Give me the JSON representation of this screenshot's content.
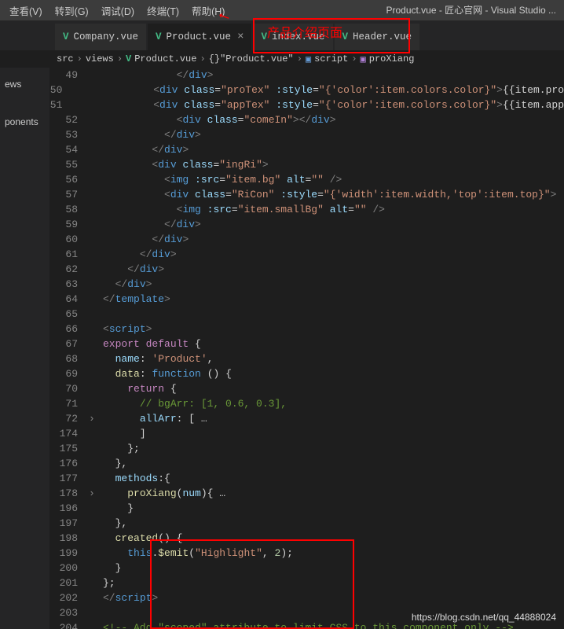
{
  "title_bar": "Product.vue - 匠心官网 - Visual Studio ...",
  "menu": [
    "查看(V)",
    "转到(G)",
    "调试(D)",
    "终端(T)",
    "帮助(H)"
  ],
  "tabs": [
    {
      "label": "Company.vue",
      "active": false,
      "close": false
    },
    {
      "label": "Product.vue",
      "active": true,
      "close": true
    },
    {
      "label": "index.vue",
      "active": false,
      "close": false
    },
    {
      "label": "Header.vue",
      "active": false,
      "close": false
    }
  ],
  "annotation": "产品介绍页面",
  "breadcrumbs": {
    "parts": [
      "src",
      "views",
      "Product.vue",
      "{}",
      "\"Product.vue\"",
      "script",
      "proXiang"
    ]
  },
  "sidebar": [
    "ews",
    "ponents"
  ],
  "lines": [
    {
      "n": 49,
      "fold": "",
      "html": "            <span class='c-tag'>&lt;/</span><span class='c-elem'>div</span><span class='c-tag'>&gt;</span>"
    },
    {
      "n": 50,
      "fold": "",
      "html": "            <span class='c-tag'>&lt;</span><span class='c-elem'>div</span> <span class='c-attr'>class</span><span class='c-punc'>=</span><span class='c-str'>\"proTex\"</span> <span class='c-attr'>:style</span><span class='c-punc'>=</span><span class='c-str'>\"{'color':item.colors.color}\"</span><span class='c-tag'>&gt;</span><span class='c-tpl'>{{item.pro</span>"
    },
    {
      "n": 51,
      "fold": "",
      "html": "            <span class='c-tag'>&lt;</span><span class='c-elem'>div</span> <span class='c-attr'>class</span><span class='c-punc'>=</span><span class='c-str'>\"appTex\"</span> <span class='c-attr'>:style</span><span class='c-punc'>=</span><span class='c-str'>\"{'color':item.colors.color}\"</span><span class='c-tag'>&gt;</span><span class='c-tpl'>{{item.app</span>"
    },
    {
      "n": 52,
      "fold": "",
      "html": "            <span class='c-tag'>&lt;</span><span class='c-elem'>div</span> <span class='c-attr'>class</span><span class='c-punc'>=</span><span class='c-str'>\"comeIn\"</span><span class='c-tag'>&gt;&lt;/</span><span class='c-elem'>div</span><span class='c-tag'>&gt;</span>"
    },
    {
      "n": 53,
      "fold": "",
      "html": "          <span class='c-tag'>&lt;/</span><span class='c-elem'>div</span><span class='c-tag'>&gt;</span>"
    },
    {
      "n": 54,
      "fold": "",
      "html": "        <span class='c-tag'>&lt;/</span><span class='c-elem'>div</span><span class='c-tag'>&gt;</span>"
    },
    {
      "n": 55,
      "fold": "",
      "html": "        <span class='c-tag'>&lt;</span><span class='c-elem'>div</span> <span class='c-attr'>class</span><span class='c-punc'>=</span><span class='c-str'>\"ingRi\"</span><span class='c-tag'>&gt;</span>"
    },
    {
      "n": 56,
      "fold": "",
      "html": "          <span class='c-tag'>&lt;</span><span class='c-elem'>img</span> <span class='c-attr'>:src</span><span class='c-punc'>=</span><span class='c-str'>\"item.bg\"</span> <span class='c-attr'>alt</span><span class='c-punc'>=</span><span class='c-str'>\"\"</span> <span class='c-tag'>/&gt;</span>"
    },
    {
      "n": 57,
      "fold": "",
      "html": "          <span class='c-tag'>&lt;</span><span class='c-elem'>div</span> <span class='c-attr'>class</span><span class='c-punc'>=</span><span class='c-str'>\"RiCon\"</span> <span class='c-attr'>:style</span><span class='c-punc'>=</span><span class='c-str'>\"{'width':item.width,'top':item.top}\"</span><span class='c-tag'>&gt;</span>"
    },
    {
      "n": 58,
      "fold": "",
      "html": "            <span class='c-tag'>&lt;</span><span class='c-elem'>img</span> <span class='c-attr'>:src</span><span class='c-punc'>=</span><span class='c-str'>\"item.smallBg\"</span> <span class='c-attr'>alt</span><span class='c-punc'>=</span><span class='c-str'>\"\"</span> <span class='c-tag'>/&gt;</span>"
    },
    {
      "n": 59,
      "fold": "",
      "html": "          <span class='c-tag'>&lt;/</span><span class='c-elem'>div</span><span class='c-tag'>&gt;</span>"
    },
    {
      "n": 60,
      "fold": "",
      "html": "        <span class='c-tag'>&lt;/</span><span class='c-elem'>div</span><span class='c-tag'>&gt;</span>"
    },
    {
      "n": 61,
      "fold": "",
      "html": "      <span class='c-tag'>&lt;/</span><span class='c-elem'>div</span><span class='c-tag'>&gt;</span>"
    },
    {
      "n": 62,
      "fold": "",
      "html": "    <span class='c-tag'>&lt;/</span><span class='c-elem'>div</span><span class='c-tag'>&gt;</span>"
    },
    {
      "n": 63,
      "fold": "",
      "html": "  <span class='c-tag'>&lt;/</span><span class='c-elem'>div</span><span class='c-tag'>&gt;</span>"
    },
    {
      "n": 64,
      "fold": "",
      "html": "<span class='c-tag'>&lt;/</span><span class='c-elem'>template</span><span class='c-tag'>&gt;</span>"
    },
    {
      "n": 65,
      "fold": "",
      "html": ""
    },
    {
      "n": 66,
      "fold": "",
      "html": "<span class='c-tag'>&lt;</span><span class='c-elem'>script</span><span class='c-tag'>&gt;</span>"
    },
    {
      "n": 67,
      "fold": "",
      "html": "<span class='c-kw2'>export</span> <span class='c-kw2'>default</span> <span class='c-punc'>{</span>"
    },
    {
      "n": 68,
      "fold": "",
      "html": "  <span class='c-prop'>name</span><span class='c-punc'>:</span> <span class='c-str'>'Product'</span><span class='c-punc'>,</span>"
    },
    {
      "n": 69,
      "fold": "",
      "html": "  <span class='c-fn'>data</span><span class='c-punc'>:</span> <span class='c-kw'>function</span> <span class='c-punc'>() {</span>"
    },
    {
      "n": 70,
      "fold": "",
      "html": "    <span class='c-kw2'>return</span> <span class='c-punc'>{</span>"
    },
    {
      "n": 71,
      "fold": "",
      "html": "      <span class='c-comment'>// bgArr: [1, 0.6, 0.3],</span>"
    },
    {
      "n": 72,
      "fold": "›",
      "html": "      <span class='c-prop'>allArr</span><span class='c-punc'>: [</span> <span class='c-punc'>…</span>"
    },
    {
      "n": 174,
      "fold": "",
      "html": "      <span class='c-punc'>]</span>"
    },
    {
      "n": 175,
      "fold": "",
      "html": "    <span class='c-punc'>};</span>"
    },
    {
      "n": 176,
      "fold": "",
      "html": "  <span class='c-punc'>},</span>"
    },
    {
      "n": 177,
      "fold": "",
      "html": "  <span class='c-prop'>methods</span><span class='c-punc'>:{</span>"
    },
    {
      "n": 178,
      "fold": "›",
      "html": "    <span class='c-fn'>proXiang</span><span class='c-punc'>(</span><span class='c-var'>num</span><span class='c-punc'>){</span> <span class='c-punc'>…</span>"
    },
    {
      "n": 196,
      "fold": "",
      "html": "    <span class='c-punc'>}</span>"
    },
    {
      "n": 197,
      "fold": "",
      "html": "  <span class='c-punc'>},</span>"
    },
    {
      "n": 198,
      "fold": "",
      "html": "  <span class='c-fn'>created</span><span class='c-punc'>() {</span>"
    },
    {
      "n": 199,
      "fold": "",
      "html": "    <span class='c-this'>this</span><span class='c-punc'>.</span><span class='c-fn'>$emit</span><span class='c-punc'>(</span><span class='c-str'>\"Highlight\"</span><span class='c-punc'>,</span> <span class='c-num'>2</span><span class='c-punc'>);</span>"
    },
    {
      "n": 200,
      "fold": "",
      "html": "  <span class='c-punc'>}</span>"
    },
    {
      "n": 201,
      "fold": "",
      "html": "<span class='c-punc'>};</span>"
    },
    {
      "n": 202,
      "fold": "",
      "html": "<span class='c-tag'>&lt;/</span><span class='c-elem'>script</span><span class='c-tag'>&gt;</span>"
    },
    {
      "n": 203,
      "fold": "",
      "html": ""
    },
    {
      "n": 204,
      "fold": "",
      "html": "<span class='c-comment'>&lt;!-- Add \"scoped\" attribute to limit CSS to this component only --&gt;</span>"
    }
  ],
  "watermark": "https://blog.csdn.net/qq_44888024"
}
